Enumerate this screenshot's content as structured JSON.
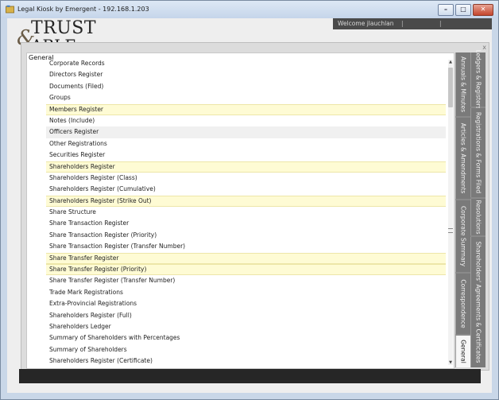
{
  "window": {
    "title": "Legal Kiosk by Emergent - 192.168.1.203",
    "buttons": {
      "minimize": "–",
      "maximize": "□",
      "close": "✕"
    }
  },
  "header": {
    "welcome": "Welcome jlauchlan",
    "separator": "|",
    "logo_top": "TRUST",
    "logo_amp": "&",
    "logo_bottom": "ABLE"
  },
  "modal": {
    "close_label": "x",
    "section_label": "General",
    "items": [
      {
        "label": "Corporate Records",
        "state": "normal"
      },
      {
        "label": "Directors Register",
        "state": "normal"
      },
      {
        "label": "Documents (Filed)",
        "state": "normal"
      },
      {
        "label": "Groups",
        "state": "normal"
      },
      {
        "label": "Members Register",
        "state": "highlighted"
      },
      {
        "label": "Notes (Include)",
        "state": "normal"
      },
      {
        "label": "Officers Register",
        "state": "selected"
      },
      {
        "label": "Other Registrations",
        "state": "normal"
      },
      {
        "label": "Securities Register",
        "state": "normal"
      },
      {
        "label": "Shareholders Register",
        "state": "highlighted"
      },
      {
        "label": "Shareholders Register (Class)",
        "state": "normal"
      },
      {
        "label": "Shareholders Register (Cumulative)",
        "state": "normal"
      },
      {
        "label": "Shareholders Register (Strike Out)",
        "state": "highlighted"
      },
      {
        "label": "Share Structure",
        "state": "normal"
      },
      {
        "label": "Share Transaction Register",
        "state": "normal"
      },
      {
        "label": "Share Transaction Register (Priority)",
        "state": "normal"
      },
      {
        "label": "Share Transaction Register (Transfer Number)",
        "state": "normal"
      },
      {
        "label": "Share Transfer Register",
        "state": "highlighted"
      },
      {
        "label": "Share Transfer Register (Priority)",
        "state": "highlighted"
      },
      {
        "label": "Share Transfer Register (Transfer Number)",
        "state": "normal"
      },
      {
        "label": "Trade Mark Registrations",
        "state": "normal"
      },
      {
        "label": "Extra-Provincial Registrations",
        "state": "normal"
      },
      {
        "label": "Shareholders Register (Full)",
        "state": "normal"
      },
      {
        "label": "Shareholders Ledger",
        "state": "normal"
      },
      {
        "label": "Summary of Shareholders with Percentages",
        "state": "normal"
      },
      {
        "label": "Summary of Shareholders",
        "state": "normal"
      },
      {
        "label": "Shareholders Register (Certificate)",
        "state": "normal"
      }
    ],
    "tabs_left": [
      {
        "label": "Annuals & Minutes"
      },
      {
        "label": "Articles & Amendments"
      },
      {
        "label": "Corporate Summary"
      },
      {
        "label": "Correspondence"
      },
      {
        "label": "General",
        "active": true
      }
    ],
    "tabs_right": [
      {
        "label": "Ledgers & Registers"
      },
      {
        "label": "Registrations & Forms Filed"
      },
      {
        "label": "Resolutions"
      },
      {
        "label": "Shareholders' Agreements & Certificates"
      }
    ]
  },
  "colors": {
    "highlight": "#fefbd4",
    "tab_bg": "#7a7a7a",
    "header_dark": "#4a4a4a"
  }
}
